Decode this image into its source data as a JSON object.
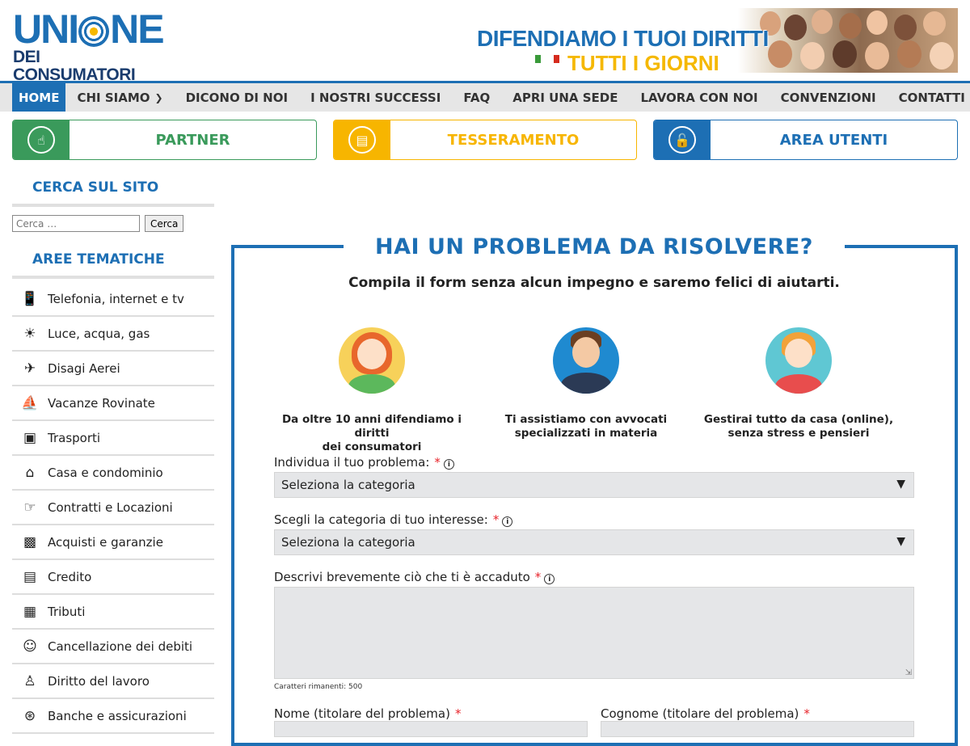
{
  "logo": {
    "line1_a": "UNI",
    "line1_b": "NE",
    "line2": "DEI CONSUMATORI"
  },
  "banner": {
    "line1": "DIFENDIAMO I TUOI DIRITTI",
    "line2": "TUTTI I GIORNI"
  },
  "nav": [
    {
      "label": "HOME"
    },
    {
      "label": "CHI SIAMO"
    },
    {
      "label": "DICONO DI NOI"
    },
    {
      "label": "I NOSTRI SUCCESSI"
    },
    {
      "label": "FAQ"
    },
    {
      "label": "APRI UNA SEDE"
    },
    {
      "label": "LAVORA CON NOI"
    },
    {
      "label": "CONVENZIONI"
    },
    {
      "label": "CONTATTI"
    }
  ],
  "quick": [
    {
      "label": "PARTNER",
      "color": "#3a9a5b",
      "icon": "handshake-icon"
    },
    {
      "label": "TESSERAMENTO",
      "color": "#f7b500",
      "icon": "id-card-icon"
    },
    {
      "label": "AREA UTENTI",
      "color": "#1d6fb4",
      "icon": "unlock-icon"
    }
  ],
  "sidebar": {
    "search_title": "CERCA SUL SITO",
    "search_placeholder": "Cerca …",
    "search_button": "Cerca",
    "areas_title": "AREE TEMATICHE",
    "areas": [
      {
        "label": "Telefonia, internet e tv",
        "icon": "phone-icon"
      },
      {
        "label": "Luce, acqua, gas",
        "icon": "bulb-icon"
      },
      {
        "label": "Disagi Aerei",
        "icon": "plane-icon"
      },
      {
        "label": "Vacanze Rovinate",
        "icon": "ship-icon"
      },
      {
        "label": "Trasporti",
        "icon": "bus-icon"
      },
      {
        "label": "Casa e condominio",
        "icon": "home-icon"
      },
      {
        "label": "Contratti e Locazioni",
        "icon": "handshake-icon"
      },
      {
        "label": "Acquisti e garanzie",
        "icon": "gift-icon"
      },
      {
        "label": "Credito",
        "icon": "money-icon"
      },
      {
        "label": "Tributi",
        "icon": "banknote-icon"
      },
      {
        "label": "Cancellazione dei debiti",
        "icon": "smile-icon"
      },
      {
        "label": "Diritto del lavoro",
        "icon": "worker-icon"
      },
      {
        "label": "Banche e assicurazioni",
        "icon": "bank-icon"
      }
    ]
  },
  "form": {
    "title": "HAI UN PROBLEMA DA RISOLVERE?",
    "subtitle": "Compila il form senza alcun impegno e saremo felici di aiutarti.",
    "features": [
      {
        "line1": "Da oltre 10 anni difendiamo i diritti",
        "line2": "dei consumatori"
      },
      {
        "line1": "Ti assistiamo con avvocati",
        "line2": "specializzati in materia"
      },
      {
        "line1": "Gestirai tutto da casa (online),",
        "line2": "senza stress e pensieri"
      }
    ],
    "problem_label": "Individua il tuo problema:",
    "problem_value": "Seleziona la categoria",
    "category_label": "Scegli la categoria di tuo interesse:",
    "category_value": "Seleziona la categoria",
    "describe_label": "Descrivi brevemente ciò che ti è accaduto",
    "counter": "Caratteri rimanenti: 500",
    "name_label": "Nome (titolare del problema)",
    "surname_label": "Cognome (titolare del problema)",
    "required_mark": "*",
    "info_mark": "i"
  }
}
